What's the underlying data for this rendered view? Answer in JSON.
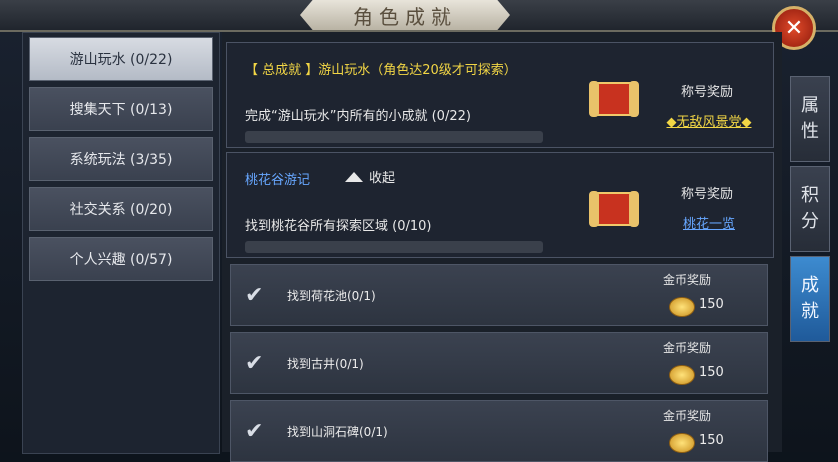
{
  "window": {
    "title": "角色成就"
  },
  "sidebar": {
    "items": [
      {
        "label": "游山玩水 (0/22)",
        "active": true
      },
      {
        "label": "搜集天下 (0/13)"
      },
      {
        "label": "系统玩法 (3/35)"
      },
      {
        "label": "社交关系 (0/20)"
      },
      {
        "label": "个人兴趣 (0/57)"
      }
    ]
  },
  "main": {
    "summary": {
      "header": "【 总成就 】游山玩水（角色达20级才可探索）",
      "description": "完成“游山玩水”内所有的小成就 (0/22)",
      "reward_label": "称号奖励",
      "reward_value": "◆无敌风景党◆",
      "progress": 0
    },
    "group": {
      "name": "桃花谷游记",
      "collapse_label": "收起",
      "description": "找到桃花谷所有探索区域 (0/10)",
      "reward_label": "称号奖励",
      "reward_value": "桃花一览",
      "progress": 0
    },
    "rows": [
      {
        "label": "找到荷花池(0/1)",
        "reward_label": "金币奖励",
        "amount": "150"
      },
      {
        "label": "找到古井(0/1)",
        "reward_label": "金币奖励",
        "amount": "150"
      },
      {
        "label": "找到山洞石碑(0/1)",
        "reward_label": "金币奖励",
        "amount": "150"
      }
    ]
  },
  "right_tabs": [
    {
      "label": "属性",
      "chars": [
        "属",
        "性"
      ]
    },
    {
      "label": "积分",
      "chars": [
        "积",
        "分"
      ]
    },
    {
      "label": "成就",
      "chars": [
        "成",
        "就"
      ],
      "active": true
    }
  ],
  "icons": {
    "close": "close-icon",
    "check": "checkmark-icon",
    "coin": "gold-coin-icon",
    "scroll": "scroll-reward-icon"
  },
  "colors": {
    "accent_gold": "#f2d645",
    "link_blue": "#67a7ff",
    "active_tab": "#3d8bd0"
  }
}
